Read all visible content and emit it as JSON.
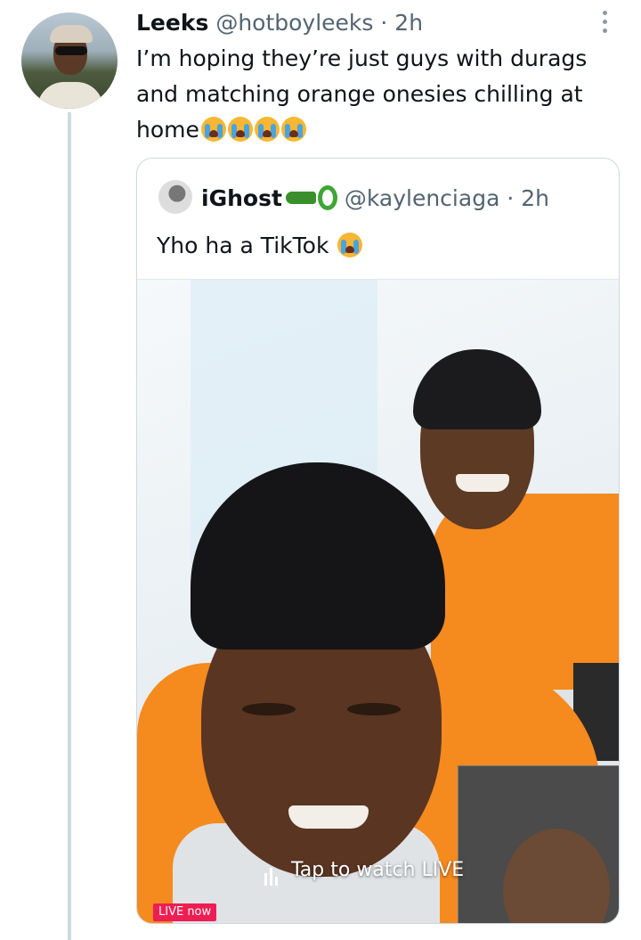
{
  "tweet": {
    "author_name": "Leeks",
    "author_handle": "@hotboyleeks",
    "separator": "·",
    "time": "2h",
    "text": "I’m hoping they’re just guys with durags and matching orange onesies chilling at home",
    "emojis": [
      "loudly-crying-face",
      "loudly-crying-face",
      "loudly-crying-face",
      "loudly-crying-face"
    ]
  },
  "quote": {
    "author_name": "iGhost",
    "author_emojis": [
      "crocodile",
      "snake"
    ],
    "author_handle": "@kaylenciaga",
    "separator": "·",
    "time": "2h",
    "text": "Yho ha a TikTok",
    "text_emoji": "loudly-crying-face",
    "media": {
      "watch_label": "Tap to watch LIVE",
      "live_badge": "LIVE now",
      "badge_color": "#ee1d52",
      "shirt_color": "#f58a1f"
    }
  }
}
